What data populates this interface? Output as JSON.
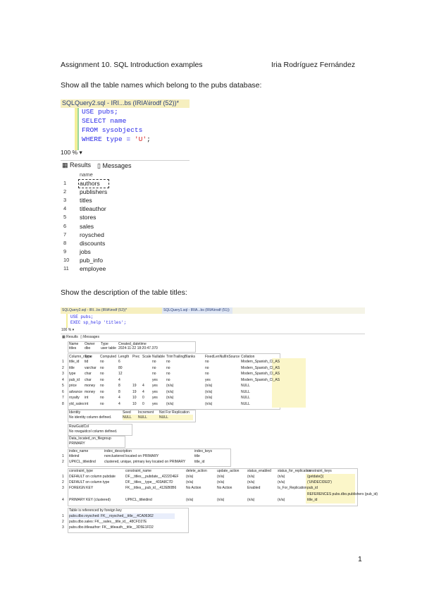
{
  "header": {
    "assignment": "Assignment 10. SQL Introduction examples",
    "author": "Iria Rodríguez Fernández"
  },
  "sections": {
    "q1": "Show all the table names which belong to the pubs database:",
    "q2": "Show the description of the table titles:"
  },
  "screenshot1": {
    "tab_title": "SQLQuery2.sql - IRI...bs (IRIA\\irodf (52))*",
    "code": [
      "USE pubs;",
      "SELECT name",
      "FROM sysobjects",
      "WHERE type = 'U';"
    ],
    "zoom": "100 %",
    "results_tab": "Results",
    "messages_tab": "Messages",
    "column_header": "name",
    "rows": [
      {
        "n": "1",
        "name": "authors"
      },
      {
        "n": "2",
        "name": "publishers"
      },
      {
        "n": "3",
        "name": "titles"
      },
      {
        "n": "4",
        "name": "titleauthor"
      },
      {
        "n": "5",
        "name": "stores"
      },
      {
        "n": "6",
        "name": "sales"
      },
      {
        "n": "7",
        "name": "roysched"
      },
      {
        "n": "8",
        "name": "discounts"
      },
      {
        "n": "9",
        "name": "jobs"
      },
      {
        "n": "10",
        "name": "pub_info"
      },
      {
        "n": "11",
        "name": "employee"
      }
    ]
  },
  "screenshot2": {
    "tab_active": "SQLQuery2.sql - IRI...bs (IRIA\\irodf (52))*",
    "tab_other": "SQLQuery1.sql - IRIA...bs (IRIA\\irodf (51))",
    "code": [
      "USE pubs;",
      "EXEC sp_help 'titles';"
    ],
    "zoom": "100 %",
    "results_tab": "Results",
    "messages_tab": "Messages",
    "obj_header": [
      "Name",
      "Owner",
      "Type",
      "Created_datetime"
    ],
    "obj_row": [
      "titles",
      "dbo",
      "user table",
      "2024-11-22 18:20:47.370"
    ],
    "col_header": [
      "Column_name",
      "Type",
      "Computed",
      "Length",
      "Prec",
      "Scale",
      "Nullable",
      "TrimTrailingBlanks",
      "FixedLenNullInSource",
      "Collation"
    ],
    "col_rows": [
      [
        "title_id",
        "tid",
        "no",
        "6",
        "",
        "",
        "no",
        "no",
        "no",
        "Modern_Spanish_CI_AS"
      ],
      [
        "title",
        "varchar",
        "no",
        "80",
        "",
        "",
        "no",
        "no",
        "no",
        "Modern_Spanish_CI_AS"
      ],
      [
        "type",
        "char",
        "no",
        "12",
        "",
        "",
        "no",
        "no",
        "no",
        "Modern_Spanish_CI_AS"
      ],
      [
        "pub_id",
        "char",
        "no",
        "4",
        "",
        "",
        "yes",
        "no",
        "yes",
        "Modern_Spanish_CI_AS"
      ],
      [
        "price",
        "money",
        "no",
        "8",
        "19",
        "4",
        "yes",
        "(n/a)",
        "(n/a)",
        "NULL"
      ],
      [
        "advance",
        "money",
        "no",
        "8",
        "19",
        "4",
        "yes",
        "(n/a)",
        "(n/a)",
        "NULL"
      ],
      [
        "royalty",
        "int",
        "no",
        "4",
        "10",
        "0",
        "yes",
        "(n/a)",
        "(n/a)",
        "NULL"
      ],
      [
        "ytd_sales",
        "int",
        "no",
        "4",
        "10",
        "0",
        "yes",
        "(n/a)",
        "(n/a)",
        "NULL"
      ]
    ],
    "identity_header": [
      "Identity",
      "Seed",
      "Increment",
      "Not For Replication"
    ],
    "identity_row": [
      "No identity column defined.",
      "NULL",
      "NULL",
      "NULL"
    ],
    "rowguid_header": "RowGuidCol",
    "rowguid_row": "No rowguidcol column defined.",
    "filegroup_header": "Data_located_on_filegroup",
    "filegroup_row": "PRIMARY",
    "index_header": [
      "index_name",
      "index_description",
      "index_keys"
    ],
    "index_rows": [
      [
        "titleind",
        "nonclustered located on PRIMARY",
        "title"
      ],
      [
        "UPKCL_titleidind",
        "clustered, unique, primary key located on PRIMARY",
        "title_id"
      ]
    ],
    "constraint_header": [
      "constraint_type",
      "constraint_name",
      "delete_action",
      "update_action",
      "status_enabled",
      "status_for_replication",
      "constraint_keys"
    ],
    "constraint_rows": [
      [
        "DEFAULT on column pubdate",
        "DF__titles__pubdate__4222D4EF",
        "(n/a)",
        "(n/a)",
        "(n/a)",
        "(n/a)",
        "(getdate())"
      ],
      [
        "DEFAULT on column type",
        "DF__titles__type__403A8C7D",
        "(n/a)",
        "(n/a)",
        "(n/a)",
        "(n/a)",
        "('UNDECIDED')"
      ],
      [
        "FOREIGN KEY",
        "FK__titles__pub_id__412EB0B6",
        "No Action",
        "No Action",
        "Enabled",
        "Is_For_Replication",
        "pub_id"
      ],
      [
        "",
        "",
        "",
        "",
        "",
        "",
        "REFERENCES pubs.dbo.publishers (pub_id)"
      ],
      [
        "PRIMARY KEY (clustered)",
        "UPKCL_titleidind",
        "(n/a)",
        "(n/a)",
        "(n/a)",
        "(n/a)",
        "title_id"
      ]
    ],
    "ref_header": "Table is referenced by foreign key",
    "ref_rows": [
      [
        "1",
        "pubs.dbo.roysched: FK__roysched__title__4CA06362"
      ],
      [
        "2",
        "pubs.dbo.sales: FK__sales__title_id__48CFD27E"
      ],
      [
        "3",
        "pubs.dbo.titleauthor: FK__titleauth__title__3D5E1FD2"
      ]
    ]
  },
  "footer": {
    "page_number": "1"
  },
  "colors": {
    "tab_yellow": "#f6efbf",
    "keyword_blue": "#2a2ae8",
    "string_red": "#d62020"
  }
}
